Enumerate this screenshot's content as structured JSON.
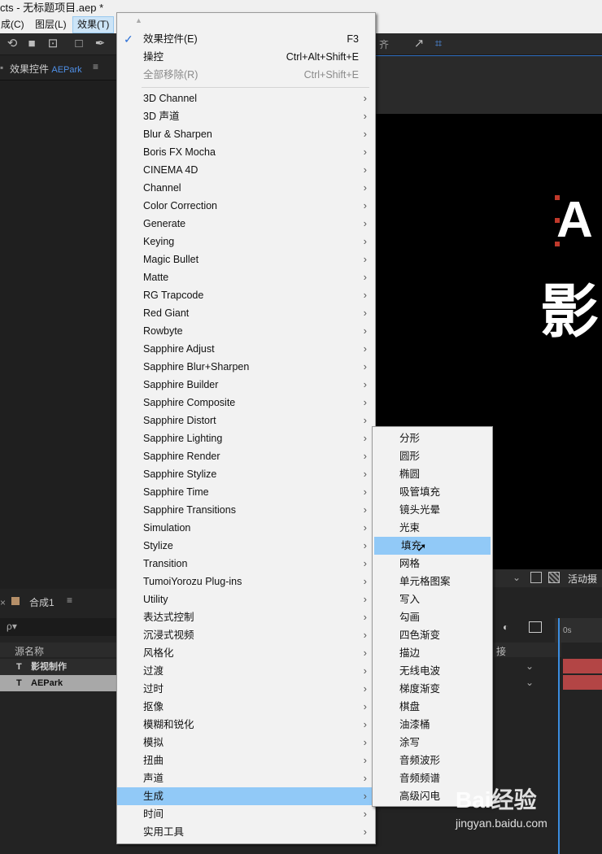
{
  "window": {
    "title": "cts - 无标题项目.aep *"
  },
  "menubar": {
    "items": [
      "成(C)",
      "图层(L)",
      "效果(T)"
    ]
  },
  "toolbar": {
    "right_label": "齐"
  },
  "panel": {
    "title": "效果控件",
    "title_highlight": "AEPark"
  },
  "comp_view": {
    "text_a": "A",
    "text_ying": "影"
  },
  "comp_footer": {
    "label": "活动摄"
  },
  "timeline": {
    "tab_label": "合成1",
    "search_icon_label": "ρ▾",
    "column_source_name": "源名称",
    "column_parent": "接",
    "time_label": "0s",
    "layers": [
      {
        "type_icon": "T",
        "name": "影视制作"
      },
      {
        "type_icon": "T",
        "name": "AEPark"
      }
    ]
  },
  "effect_menu": {
    "top_items": [
      {
        "label": "效果控件(E)",
        "shortcut": "F3",
        "checked": true,
        "disabled": false
      },
      {
        "label": "操控",
        "shortcut": "Ctrl+Alt+Shift+E",
        "checked": false,
        "disabled": false
      },
      {
        "label": "全部移除(R)",
        "shortcut": "Ctrl+Shift+E",
        "checked": false,
        "disabled": true
      }
    ],
    "categories": [
      "3D Channel",
      "3D 声道",
      "Blur & Sharpen",
      "Boris FX Mocha",
      "CINEMA 4D",
      "Channel",
      "Color Correction",
      "Generate",
      "Keying",
      "Magic Bullet",
      "Matte",
      "RG Trapcode",
      "Red Giant",
      "Rowbyte",
      "Sapphire Adjust",
      "Sapphire Blur+Sharpen",
      "Sapphire Builder",
      "Sapphire Composite",
      "Sapphire Distort",
      "Sapphire Lighting",
      "Sapphire Render",
      "Sapphire Stylize",
      "Sapphire Time",
      "Sapphire Transitions",
      "Simulation",
      "Stylize",
      "Transition",
      "TumoiYorozu Plug-ins",
      "Utility",
      "表达式控制",
      "沉浸式视频",
      "风格化",
      "过渡",
      "过时",
      "抠像",
      "模糊和锐化",
      "模拟",
      "扭曲",
      "声道",
      "生成",
      "时间",
      "实用工具"
    ],
    "selected_category": "生成"
  },
  "generate_submenu": {
    "items": [
      "分形",
      "圆形",
      "椭圆",
      "吸管填充",
      "镜头光晕",
      "光束",
      "填充",
      "网格",
      "单元格图案",
      "写入",
      "勾画",
      "四色渐变",
      "描边",
      "无线电波",
      "梯度渐变",
      "棋盘",
      "油漆桶",
      "涂写",
      "音频波形",
      "音频频谱",
      "高级闪电"
    ],
    "hovered": "填充"
  },
  "watermark": {
    "text": "Bai经验",
    "url_text": "jingyan.baidu.com"
  },
  "colors": {
    "menu_highlight": "#91c9f7",
    "accent_blue": "#4f8fe6",
    "layer_red": "#c0392b"
  }
}
